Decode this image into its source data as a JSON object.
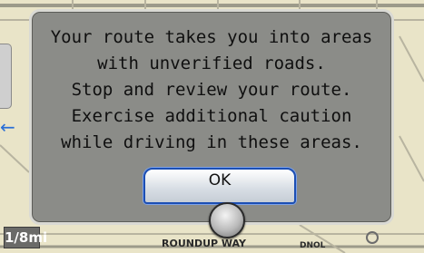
{
  "map": {
    "scale_label": "1/8mi",
    "street_bottom": "ROUNDUP WAY",
    "street_bottom_right": "DNOL"
  },
  "dialog": {
    "message_lines": [
      "Your route takes you into areas",
      "with unverified roads.",
      "Stop and review your route.",
      "Exercise additional caution",
      "while driving in these areas."
    ],
    "ok_label": "OK"
  },
  "colors": {
    "map_background": "#e9e4c8",
    "dialog_background": "#8b8c88",
    "button_border": "#1c4fb4",
    "left_arrow": "#2b6fd6"
  },
  "icons": {
    "left_arrow": "arrow-left-icon",
    "knob": "selector-knob-icon"
  }
}
